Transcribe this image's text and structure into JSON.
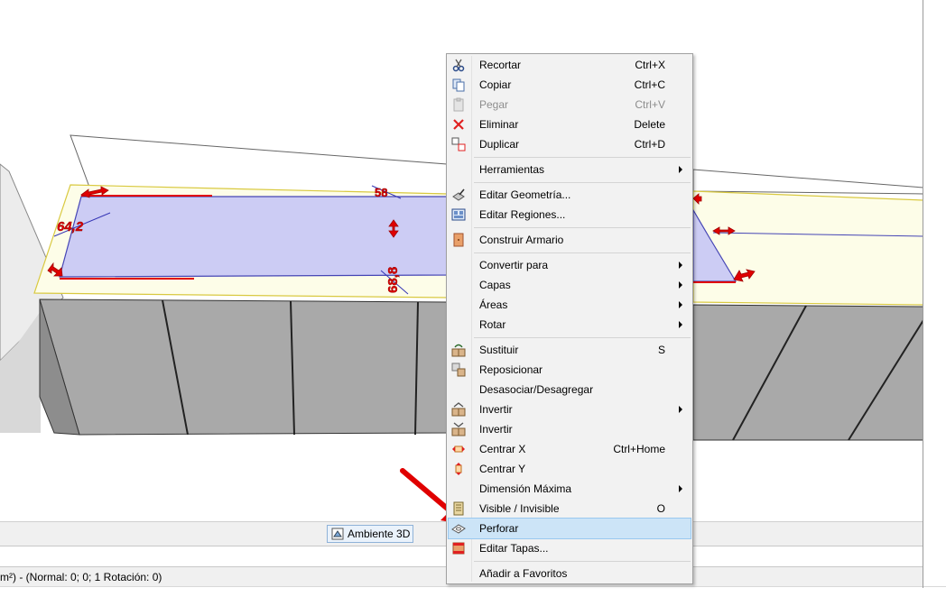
{
  "viewport": {
    "dimension_labels": [
      "64,2",
      "58",
      "68,8"
    ]
  },
  "tabs": {
    "ambiente_label": "Ambiente 3D"
  },
  "status": {
    "text": "m²) - (Normal: 0; 0; 1 Rotación: 0)"
  },
  "menu": {
    "items": [
      {
        "label": "Recortar",
        "shortcut": "Ctrl+X",
        "icon": "scissors-icon"
      },
      {
        "label": "Copiar",
        "shortcut": "Ctrl+C",
        "icon": "copy-icon"
      },
      {
        "label": "Pegar",
        "shortcut": "Ctrl+V",
        "icon": "paste-icon",
        "disabled": true
      },
      {
        "label": "Eliminar",
        "shortcut": "Delete",
        "icon": "delete-x-icon"
      },
      {
        "label": "Duplicar",
        "shortcut": "Ctrl+D",
        "icon": "duplicate-icon"
      },
      {
        "label": "Herramientas",
        "submenu": true
      },
      {
        "label": "Editar Geometría...",
        "icon": "edit-geometry-icon"
      },
      {
        "label": "Editar Regiones...",
        "icon": "edit-regions-icon"
      },
      {
        "label": "Construir Armario",
        "icon": "build-cabinet-icon"
      },
      {
        "label": "Convertir para",
        "submenu": true
      },
      {
        "label": "Capas",
        "submenu": true
      },
      {
        "label": "Áreas",
        "submenu": true
      },
      {
        "label": "Rotar",
        "submenu": true
      },
      {
        "label": "Sustituir",
        "shortcut": "S",
        "icon": "substitute-icon"
      },
      {
        "label": "Reposicionar",
        "icon": "reposition-icon"
      },
      {
        "label": "Desasociar/Desagregar"
      },
      {
        "label": "Invertir",
        "submenu": true,
        "icon": "invert-icon"
      },
      {
        "label": "Invertir",
        "icon": "invert-2-icon"
      },
      {
        "label": "Centrar X",
        "shortcut": "Ctrl+Home",
        "icon": "center-x-icon"
      },
      {
        "label": "Centrar Y",
        "icon": "center-y-icon"
      },
      {
        "label": "Dimensión Máxima",
        "submenu": true
      },
      {
        "label": "Visible / Invisible",
        "shortcut": "O",
        "icon": "visibility-icon"
      },
      {
        "label": "Perforar",
        "icon": "perforate-icon",
        "highlighted": true
      },
      {
        "label": "Editar Tapas...",
        "icon": "edit-caps-icon"
      },
      {
        "label": "Añadir a Favoritos"
      }
    ]
  },
  "colors": {
    "menu_highlight": "#cce4f7",
    "annotation_red": "#e00000",
    "selection_fill": "#c9c9f5",
    "countertop": "#fdfde8"
  }
}
